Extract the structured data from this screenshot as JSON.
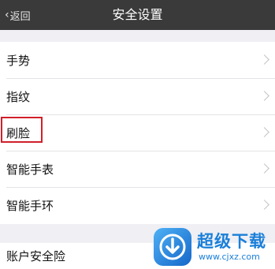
{
  "nav": {
    "back_label": "返回",
    "title": "安全设置"
  },
  "settings": {
    "items": [
      {
        "label": "手势"
      },
      {
        "label": "指纹"
      },
      {
        "label": "刷脸"
      },
      {
        "label": "智能手表"
      },
      {
        "label": "智能手环"
      }
    ],
    "account_item": {
      "label": "账户安全险"
    }
  },
  "watermark": {
    "title": "超级下载",
    "url": "www.cjxz.com"
  },
  "colors": {
    "nav_background": "#3a3a3a",
    "page_background": "#efeff4",
    "highlight_border": "#d0202a",
    "watermark_blue": "#1a7fd9"
  }
}
